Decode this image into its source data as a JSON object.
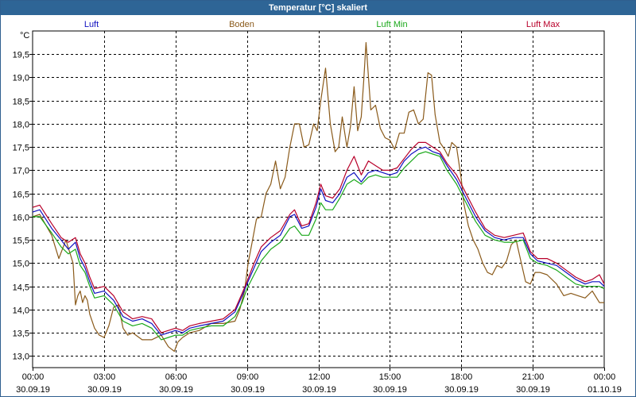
{
  "window": {
    "title": "Temperatur [°C] skaliert"
  },
  "chart_data": {
    "type": "line",
    "title": "Temperatur [°C] skaliert",
    "ylabel": "°C",
    "ylim": [
      12.75,
      20.0
    ],
    "y_ticks": [
      "13,0",
      "13,5",
      "14,0",
      "14,5",
      "15,0",
      "15,5",
      "16,0",
      "16,5",
      "17,0",
      "17,5",
      "18,0",
      "18,5",
      "19,0",
      "19,5"
    ],
    "y_tick_values": [
      13.0,
      13.5,
      14.0,
      14.5,
      15.0,
      15.5,
      16.0,
      16.5,
      17.0,
      17.5,
      18.0,
      18.5,
      19.0,
      19.5
    ],
    "x_range_hours": [
      0,
      24
    ],
    "x_ticks": [
      {
        "time": "00:00",
        "date": "30.09.19",
        "hour": 0
      },
      {
        "time": "03:00",
        "date": "30.09.19",
        "hour": 3
      },
      {
        "time": "06:00",
        "date": "30.09.19",
        "hour": 6
      },
      {
        "time": "09:00",
        "date": "30.09.19",
        "hour": 9
      },
      {
        "time": "12:00",
        "date": "30.09.19",
        "hour": 12
      },
      {
        "time": "15:00",
        "date": "30.09.19",
        "hour": 15
      },
      {
        "time": "18:00",
        "date": "30.09.19",
        "hour": 18
      },
      {
        "time": "21:00",
        "date": "30.09.19",
        "hour": 21
      },
      {
        "time": "00:00",
        "date": "01.10.19",
        "hour": 24
      }
    ],
    "grid": true,
    "series": [
      {
        "name": "Luft",
        "color": "#1010c0",
        "x": [
          0,
          0.3,
          0.8,
          1.2,
          1.5,
          1.8,
          2.0,
          2.2,
          2.4,
          2.6,
          3.0,
          3.4,
          3.8,
          4.2,
          4.6,
          5.0,
          5.4,
          5.7,
          6.0,
          6.3,
          6.6,
          7.0,
          7.5,
          8.0,
          8.5,
          8.8,
          9.0,
          9.3,
          9.6,
          10.0,
          10.4,
          10.8,
          11.0,
          11.3,
          11.6,
          11.9,
          12.1,
          12.3,
          12.6,
          12.9,
          13.2,
          13.5,
          13.8,
          14.1,
          14.4,
          14.7,
          15.0,
          15.3,
          15.6,
          15.9,
          16.2,
          16.5,
          16.8,
          17.1,
          17.4,
          17.8,
          18.2,
          18.6,
          19.0,
          19.4,
          19.8,
          20.2,
          20.6,
          20.9,
          21.2,
          21.6,
          22.0,
          22.4,
          22.8,
          23.2,
          23.5,
          23.8,
          24.0
        ],
        "values": [
          16.1,
          16.15,
          15.75,
          15.5,
          15.3,
          15.45,
          15.1,
          14.9,
          14.6,
          14.35,
          14.4,
          14.2,
          13.85,
          13.75,
          13.8,
          13.7,
          13.45,
          13.5,
          13.55,
          13.5,
          13.6,
          13.65,
          13.7,
          13.75,
          13.95,
          14.3,
          14.55,
          14.9,
          15.25,
          15.45,
          15.6,
          16.0,
          16.05,
          15.75,
          15.8,
          16.2,
          16.6,
          16.35,
          16.3,
          16.5,
          16.85,
          16.95,
          16.75,
          16.95,
          17.0,
          16.95,
          16.9,
          16.95,
          17.2,
          17.35,
          17.45,
          17.5,
          17.4,
          17.35,
          17.1,
          16.8,
          16.4,
          16.0,
          15.7,
          15.55,
          15.5,
          15.55,
          15.55,
          15.2,
          15.05,
          15.0,
          14.95,
          14.8,
          14.65,
          14.55,
          14.6,
          14.6,
          14.5
        ]
      },
      {
        "name": "Boden",
        "color": "#8a5a1a",
        "x": [
          0,
          0.3,
          0.8,
          1.1,
          1.4,
          1.7,
          1.8,
          1.9,
          2.0,
          2.1,
          2.2,
          2.3,
          2.4,
          2.6,
          2.8,
          3.0,
          3.2,
          3.4,
          3.6,
          3.8,
          4.0,
          4.2,
          4.6,
          5.0,
          5.4,
          5.7,
          5.95,
          6.1,
          6.3,
          6.6,
          7.0,
          7.5,
          8.0,
          8.5,
          8.7,
          8.9,
          9.05,
          9.2,
          9.4,
          9.6,
          9.8,
          10.0,
          10.2,
          10.4,
          10.6,
          10.8,
          11.0,
          11.2,
          11.4,
          11.6,
          11.8,
          11.95,
          12.1,
          12.3,
          12.5,
          12.7,
          12.85,
          13.0,
          13.2,
          13.35,
          13.5,
          13.65,
          13.8,
          13.9,
          14.0,
          14.2,
          14.4,
          14.6,
          14.8,
          15.0,
          15.2,
          15.4,
          15.6,
          15.8,
          16.0,
          16.2,
          16.4,
          16.6,
          16.75,
          16.9,
          17.1,
          17.3,
          17.45,
          17.6,
          17.8,
          18.0,
          18.1,
          18.3,
          18.5,
          18.7,
          18.9,
          19.1,
          19.3,
          19.5,
          19.7,
          19.9,
          20.1,
          20.3,
          20.5,
          20.7,
          20.9,
          21.1,
          21.3,
          21.6,
          22.0,
          22.3,
          22.6,
          22.9,
          23.2,
          23.5,
          23.8,
          24.0
        ],
        "values": [
          16.0,
          16.05,
          15.6,
          15.1,
          15.5,
          15.0,
          14.1,
          14.3,
          14.4,
          14.15,
          14.3,
          14.2,
          13.9,
          13.6,
          13.45,
          13.4,
          13.65,
          14.05,
          14.1,
          13.6,
          13.45,
          13.5,
          13.35,
          13.35,
          13.45,
          13.2,
          13.1,
          13.3,
          13.4,
          13.5,
          13.55,
          13.7,
          13.7,
          13.75,
          14.0,
          14.4,
          15.0,
          15.4,
          15.95,
          16.0,
          16.5,
          16.7,
          17.2,
          16.6,
          16.85,
          17.5,
          18.0,
          18.0,
          17.5,
          17.55,
          18.0,
          17.85,
          18.5,
          19.2,
          18.0,
          17.4,
          17.5,
          18.15,
          17.5,
          17.95,
          18.8,
          17.85,
          18.15,
          18.9,
          19.75,
          18.3,
          18.4,
          17.9,
          17.7,
          17.65,
          17.45,
          17.8,
          17.8,
          18.25,
          18.3,
          18.0,
          18.1,
          19.1,
          19.05,
          18.2,
          17.6,
          17.45,
          17.3,
          17.6,
          17.5,
          16.8,
          16.3,
          15.8,
          15.5,
          15.3,
          15.0,
          14.8,
          14.75,
          14.95,
          14.9,
          15.05,
          15.4,
          15.5,
          15.05,
          14.6,
          14.55,
          14.8,
          14.8,
          14.75,
          14.55,
          14.3,
          14.35,
          14.3,
          14.25,
          14.4,
          14.15,
          14.15
        ]
      },
      {
        "name": "Luft Min",
        "color": "#1aa81a",
        "x": [
          0,
          0.3,
          0.8,
          1.2,
          1.5,
          1.8,
          2.0,
          2.2,
          2.4,
          2.6,
          3.0,
          3.4,
          3.8,
          4.2,
          4.6,
          5.0,
          5.4,
          5.7,
          6.0,
          6.3,
          6.6,
          7.0,
          7.5,
          8.0,
          8.5,
          8.8,
          9.0,
          9.3,
          9.6,
          10.0,
          10.4,
          10.8,
          11.0,
          11.3,
          11.6,
          11.9,
          12.1,
          12.3,
          12.6,
          12.9,
          13.2,
          13.5,
          13.8,
          14.1,
          14.4,
          14.7,
          15.0,
          15.3,
          15.6,
          15.9,
          16.2,
          16.5,
          16.8,
          17.1,
          17.4,
          17.8,
          18.2,
          18.6,
          19.0,
          19.4,
          19.8,
          20.2,
          20.6,
          20.9,
          21.2,
          21.6,
          22.0,
          22.4,
          22.8,
          23.2,
          23.5,
          23.8,
          24.0
        ],
        "values": [
          16.0,
          16.0,
          15.65,
          15.35,
          15.2,
          15.3,
          14.95,
          14.8,
          14.5,
          14.25,
          14.3,
          14.1,
          13.75,
          13.65,
          13.7,
          13.6,
          13.35,
          13.4,
          13.45,
          13.45,
          13.55,
          13.6,
          13.65,
          13.65,
          13.85,
          14.15,
          14.45,
          14.75,
          15.05,
          15.3,
          15.45,
          15.75,
          15.8,
          15.6,
          15.6,
          15.95,
          16.3,
          16.15,
          16.15,
          16.4,
          16.7,
          16.8,
          16.7,
          16.85,
          16.9,
          16.85,
          16.85,
          16.85,
          17.05,
          17.2,
          17.35,
          17.4,
          17.35,
          17.3,
          17.0,
          16.7,
          16.3,
          15.9,
          15.6,
          15.5,
          15.45,
          15.45,
          15.5,
          15.1,
          15.0,
          14.95,
          14.85,
          14.7,
          14.55,
          14.5,
          14.5,
          14.5,
          14.45
        ]
      },
      {
        "name": "Luft Max",
        "color": "#b8002a",
        "x": [
          0,
          0.3,
          0.8,
          1.2,
          1.5,
          1.8,
          2.0,
          2.2,
          2.4,
          2.6,
          3.0,
          3.4,
          3.8,
          4.2,
          4.6,
          5.0,
          5.4,
          5.7,
          6.0,
          6.3,
          6.6,
          7.0,
          7.5,
          8.0,
          8.5,
          8.8,
          9.0,
          9.3,
          9.6,
          10.0,
          10.4,
          10.8,
          11.0,
          11.3,
          11.6,
          11.9,
          12.1,
          12.3,
          12.6,
          12.9,
          13.2,
          13.5,
          13.8,
          14.1,
          14.4,
          14.7,
          15.0,
          15.3,
          15.6,
          15.9,
          16.2,
          16.5,
          16.8,
          17.1,
          17.4,
          17.8,
          18.2,
          18.6,
          19.0,
          19.4,
          19.8,
          20.2,
          20.6,
          20.9,
          21.2,
          21.6,
          22.0,
          22.4,
          22.8,
          23.2,
          23.5,
          23.8,
          24.0
        ],
        "values": [
          16.2,
          16.25,
          15.85,
          15.55,
          15.45,
          15.55,
          15.2,
          15.0,
          14.7,
          14.45,
          14.5,
          14.3,
          13.95,
          13.8,
          13.85,
          13.8,
          13.5,
          13.55,
          13.6,
          13.55,
          13.65,
          13.7,
          13.75,
          13.8,
          14.0,
          14.35,
          14.6,
          15.0,
          15.35,
          15.55,
          15.7,
          16.05,
          16.15,
          15.8,
          15.85,
          16.3,
          16.7,
          16.45,
          16.4,
          16.6,
          17.0,
          17.3,
          16.9,
          17.2,
          17.1,
          17.0,
          17.0,
          17.05,
          17.25,
          17.45,
          17.6,
          17.6,
          17.5,
          17.4,
          17.15,
          16.9,
          16.5,
          16.1,
          15.75,
          15.6,
          15.55,
          15.6,
          15.65,
          15.25,
          15.1,
          15.1,
          15.0,
          14.85,
          14.7,
          14.6,
          14.65,
          14.75,
          14.55
        ]
      }
    ]
  }
}
